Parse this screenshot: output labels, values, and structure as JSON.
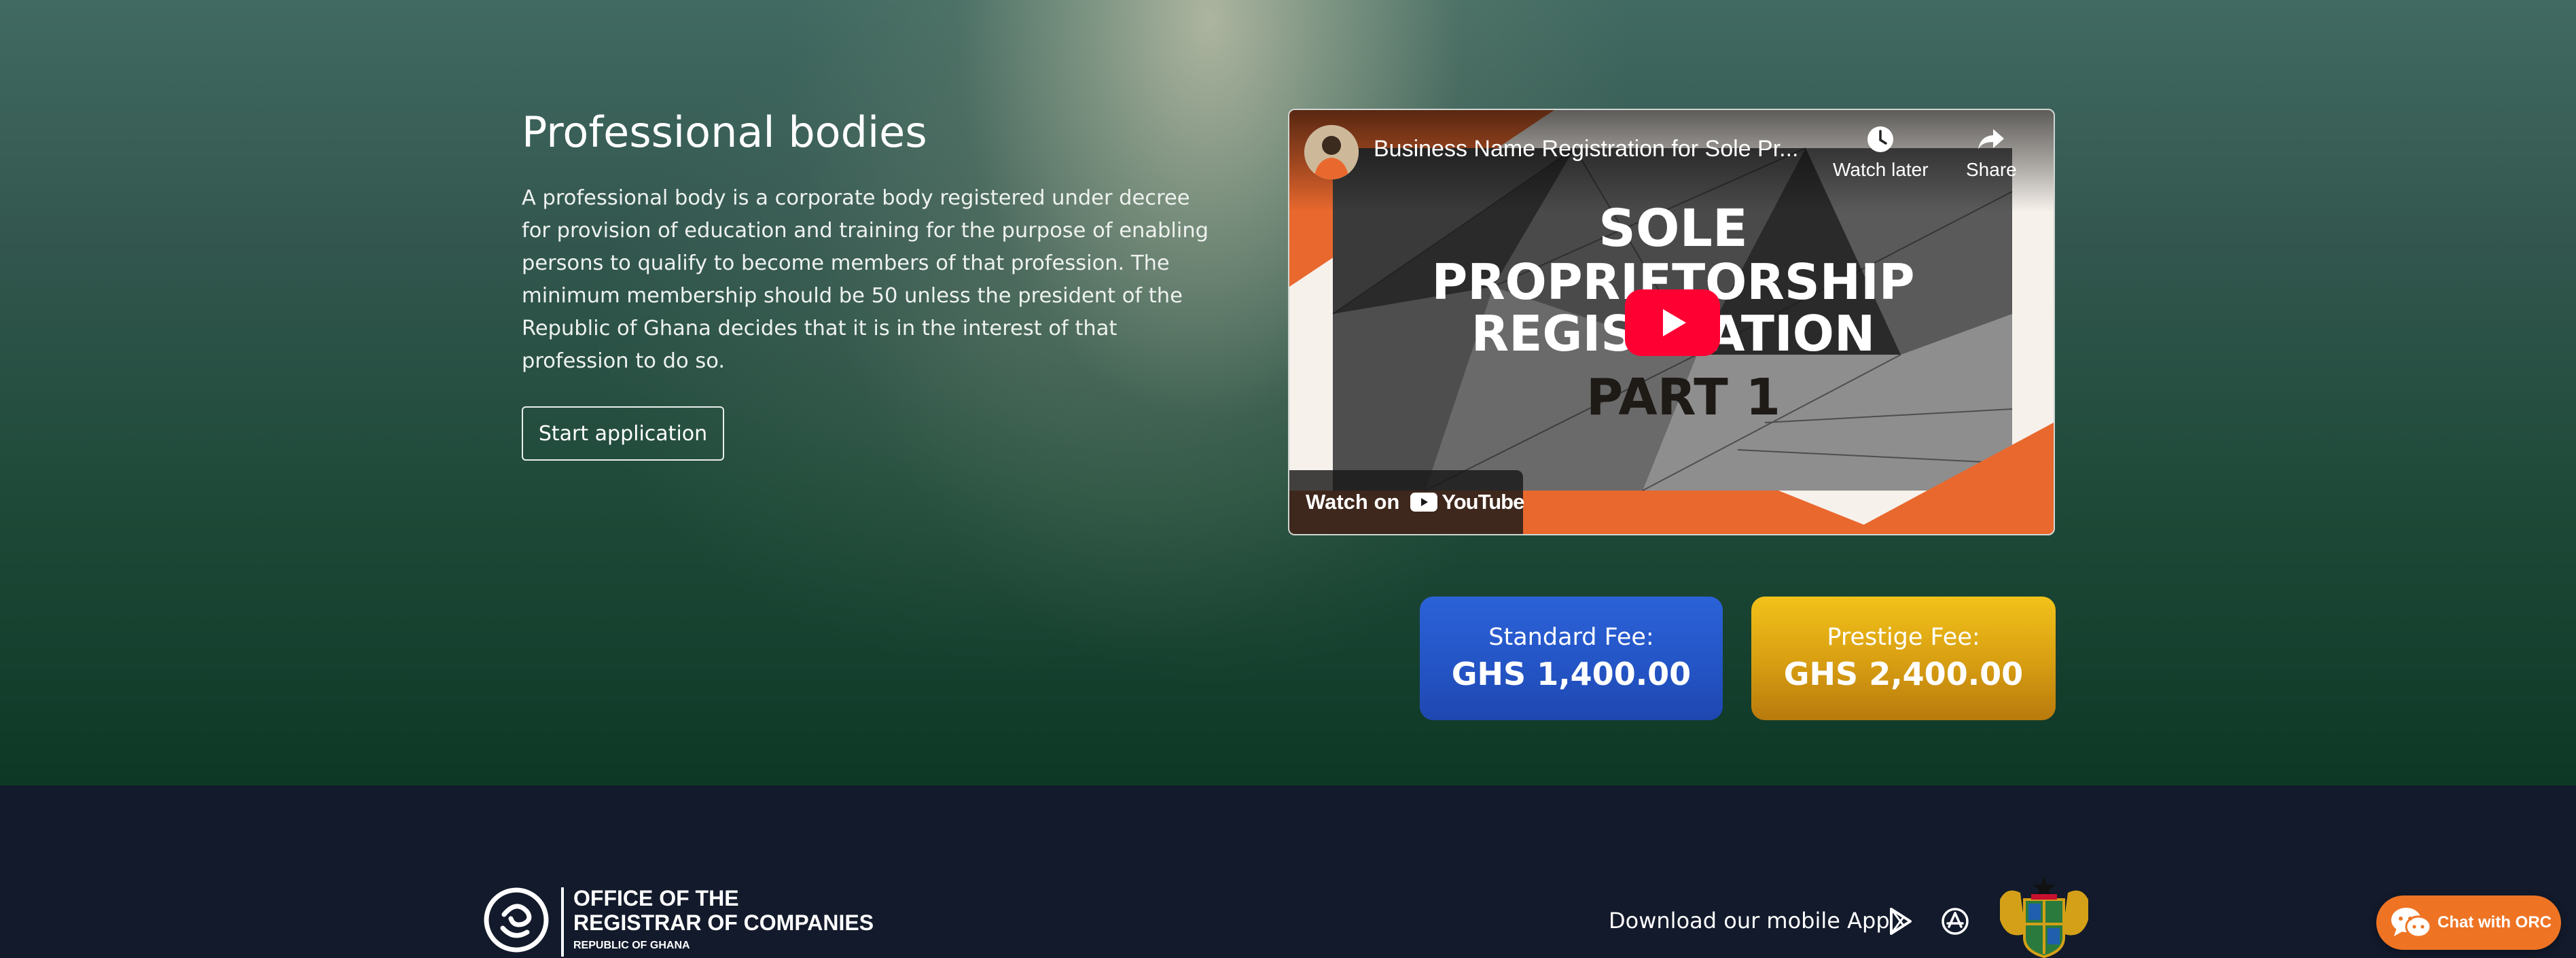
{
  "hero": {
    "title": "Professional bodies",
    "description": "A professional body is a corporate body registered under decree for provision of education and training for the purpose of enabling persons to qualify to become members of that profession. The minimum membership should be 50 unless the president of the Republic of Ghana decides that it is in the interest of that profession to do so.",
    "start_button": "Start application"
  },
  "video": {
    "title": "Business Name Registration for Sole Pr...",
    "watch_later": "Watch later",
    "share": "Share",
    "thumbnail_lines": [
      "SOLE",
      "PROPRIETORSHIP",
      "REGISTRATION",
      "PART 1"
    ],
    "watch_on": "Watch on",
    "youtube": "YouTube"
  },
  "fees": {
    "standard": {
      "label": "Standard Fee:",
      "amount": "GHS 1,400.00",
      "color": "#2455c6"
    },
    "prestige": {
      "label": "Prestige Fee:",
      "amount": "GHS 2,400.00",
      "color": "#d79d12"
    }
  },
  "footer": {
    "logo_line1": "OFFICE OF THE",
    "logo_line2": "REGISTRAR OF COMPANIES",
    "logo_line3": "REPUBLIC OF GHANA",
    "download_text": "Download our mobile App",
    "icons": [
      "play-store-icon",
      "app-store-icon",
      "ghana-coat-of-arms"
    ]
  },
  "chat": {
    "label": "Chat with ORC",
    "color": "#ee7424"
  },
  "colors": {
    "footer_bg": "#121a2b",
    "hero_dark_green": "#0e3826",
    "youtube_red": "#ff0033",
    "thumbnail_orange": "#e9682e"
  }
}
